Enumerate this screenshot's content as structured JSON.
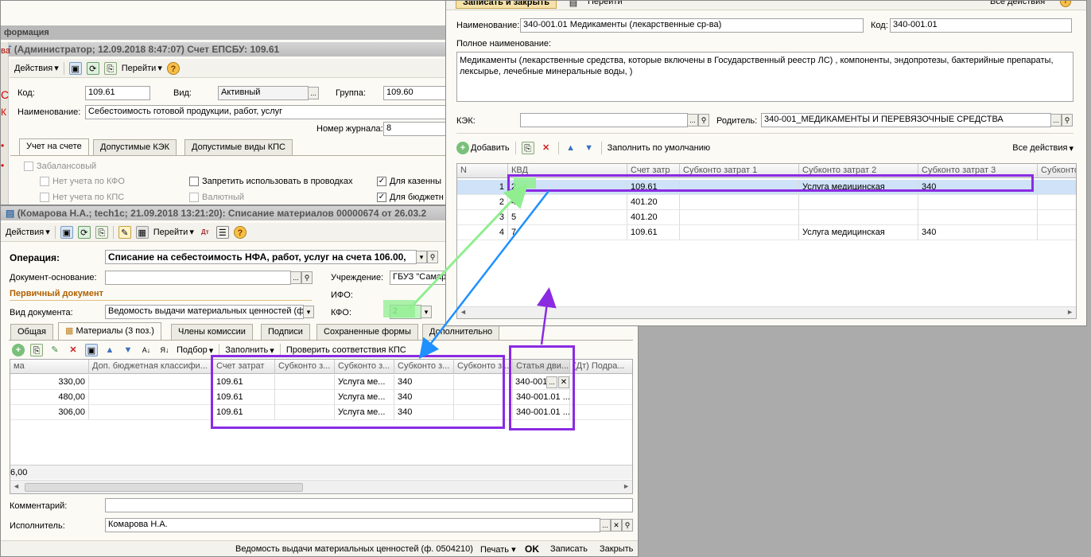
{
  "acct": {
    "title_prefix": "формация",
    "title": "(Администратор; 12.09.2018 8:47:07) Счет ЕПСБУ: 109.61",
    "left_hint": "ва",
    "toolbar": {
      "actions": "Действия",
      "goto": "Перейти"
    },
    "kod_label": "Код:",
    "kod": "109.61",
    "vid_label": "Вид:",
    "vid": "Активный",
    "group_label": "Группа:",
    "group": "109.60",
    "name_label": "Наименование:",
    "name": "Себестоимость готовой продукции, работ, услуг",
    "journal_label": "Номер журнала:",
    "journal": "8",
    "tabs": [
      "Учет на счете",
      "Допустимые КЭК",
      "Допустимые виды КПС"
    ],
    "checks": {
      "offbalance": "Забалансовый",
      "no_kfo": "Нет учета по КФО",
      "no_kps": "Нет учета по КПС",
      "forbid": "Запретить использовать в проводках",
      "currency": "Валютный",
      "treasury": "Для казенны",
      "budget": "Для бюджетн"
    }
  },
  "doc": {
    "title": "(Комарова Н.А.; tech1c; 21.09.2018 13:21:20): Списание материалов 00000674 от 26.03.2",
    "toolbar": {
      "actions": "Действия",
      "goto": "Перейти"
    },
    "operation_label": "Операция:",
    "operation": "Списание на себестоимость НФА, работ, услуг на счета 106.00,",
    "base_label": "Документ-основание:",
    "inst_label": "Учреждение:",
    "inst": "ГБУЗ \"Самар",
    "primary": "Первичный документ",
    "ifo_label": "ИФО:",
    "doctype_label": "Вид документа:",
    "doctype": "Ведомость выдачи материальных ценностей (ф",
    "kfo_label": "КФО:",
    "kfo": "2",
    "tabs": [
      "Общая",
      "Материалы (3 поз.)",
      "Члены комиссии",
      "Подписи",
      "Сохраненные формы",
      "Дополнительно"
    ],
    "table_toolbar": {
      "select": "Подбор",
      "fill": "Заполнить",
      "check": "Проверить соответствия КПС"
    },
    "columns": [
      "ма",
      "Доп. бюджетная классифи...",
      "Счет затрат",
      "Субконто з...",
      "Субконто з...",
      "Субконто з...",
      "Субконто з...",
      "Статья дви...",
      "(Дт) Подра..."
    ],
    "rows": [
      [
        "330,00",
        "",
        "109.61",
        "",
        "Услуга ме...",
        "340",
        "",
        "340-001"
      ],
      [
        "480,00",
        "",
        "109.61",
        "",
        "Услуга ме...",
        "340",
        "",
        "340-001.01 ..."
      ],
      [
        "306,00",
        "",
        "109.61",
        "",
        "Услуга ме...",
        "340",
        "",
        "340-001.01 ..."
      ]
    ],
    "total": "6,00",
    "comment_label": "Комментарий:",
    "executor_label": "Исполнитель:",
    "executor": "Комарова Н.А.",
    "footer": {
      "form": "Ведомость выдачи материальных ценностей (ф. 0504210)",
      "print": "Печать",
      "ok": "OK",
      "save": "Записать",
      "close": "Закрыть"
    }
  },
  "item": {
    "top_actions": {
      "save_close": "Записать и закрыть",
      "goto": "Перейти",
      "all": "Все действия"
    },
    "name_label": "Наименование:",
    "name": "340-001.01 Медикаменты (лекарственные ср-ва)",
    "code_label": "Код:",
    "code": "340-001.01",
    "fullname_label": "Полное наименование:",
    "fullname": "Медикаменты (лекарственные средства, которые включены в Государственный реестр ЛС) , компоненты, эндопротезы, бактерийные препараты, лексырье, лечебные минеральные воды, )",
    "kek_label": "КЭК:",
    "parent_label": "Родитель:",
    "parent": "340-001_МЕДИКАМЕНТЫ И ПЕРЕВЯЗОЧНЫЕ СРЕДСТВА",
    "toolbar": {
      "add": "Добавить",
      "fill_default": "Заполнить по умолчанию",
      "all": "Все действия"
    },
    "columns": [
      "N",
      "КВД",
      "Счет затр",
      "Субконто затрат 1",
      "Субконто затрат 2",
      "Субконто затрат 3",
      "Субконто"
    ],
    "rows": [
      [
        "1",
        "2",
        "109.61",
        "",
        "Услуга медицинская",
        "340"
      ],
      [
        "2",
        "4",
        "401.20",
        "",
        "",
        ""
      ],
      [
        "3",
        "5",
        "401.20",
        "",
        "",
        ""
      ],
      [
        "4",
        "7",
        "109.61",
        "",
        "Услуга медицинская",
        "340"
      ]
    ]
  },
  "colors": {
    "highlight": "#8a2be2",
    "arrow_green": "#90ee90",
    "arrow_blue": "#1e90ff",
    "accent_orange": "#b06000"
  }
}
